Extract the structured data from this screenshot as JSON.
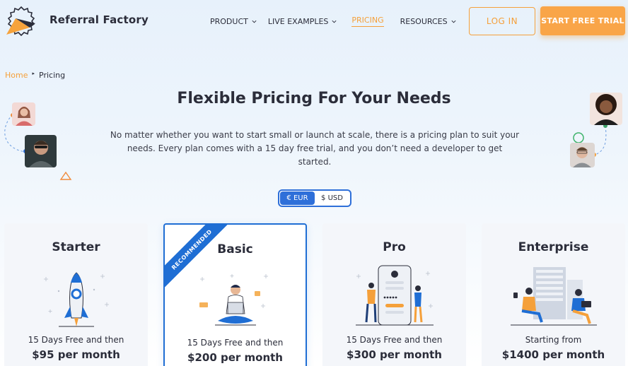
{
  "header": {
    "brand": "Referral Factory",
    "nav": [
      {
        "label": "PRODUCT",
        "has_dropdown": true,
        "active": false
      },
      {
        "label": "LIVE EXAMPLES",
        "has_dropdown": true,
        "active": false
      },
      {
        "label": "PRICING",
        "has_dropdown": false,
        "active": true
      },
      {
        "label": "RESOURCES",
        "has_dropdown": true,
        "active": false
      }
    ],
    "login_label": "LOG IN",
    "trial_label": "START FREE TRIAL"
  },
  "breadcrumb": {
    "home": "Home",
    "current": "Pricing"
  },
  "hero": {
    "title": "Flexible Pricing For Your Needs",
    "subtitle": "No matter whether you want to start small or launch at scale, there is a pricing plan to suit your needs. Every plan comes with a 15 day free trial, and you don’t need a developer to get started."
  },
  "currency": {
    "options": [
      "€ EUR",
      "$ USD"
    ],
    "selected": "€ EUR"
  },
  "plans": [
    {
      "name": "Starter",
      "sub": "15 Days Free and then",
      "price": "$95 per month",
      "recommended": false,
      "icon": "rocket-illustration"
    },
    {
      "name": "Basic",
      "sub": "15 Days Free and then",
      "price": "$200 per month",
      "recommended": true,
      "ribbon": "RECOMMENDED",
      "icon": "person-laptop-illustration"
    },
    {
      "name": "Pro",
      "sub": "15 Days Free and then",
      "price": "$300 per month",
      "recommended": false,
      "icon": "phone-team-illustration"
    },
    {
      "name": "Enterprise",
      "sub": "Starting from",
      "price": "$1400 per month",
      "recommended": false,
      "icon": "office-team-illustration"
    }
  ],
  "colors": {
    "accent": "#f5a03a",
    "primary_blue": "#1f6ed4",
    "text": "#2b2d3a"
  }
}
